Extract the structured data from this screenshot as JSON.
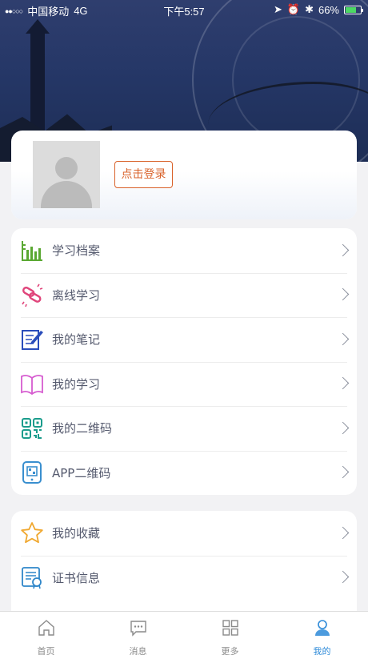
{
  "status": {
    "carrier": "中国移动",
    "network": "4G",
    "time": "下午5:57",
    "battery": "66%",
    "battery_level": 0.66
  },
  "profile": {
    "login_label": "点击登录"
  },
  "menu_group_1": [
    {
      "label": "学习档案",
      "icon": "chart-bars-icon",
      "color": "#5aa832"
    },
    {
      "label": "离线学习",
      "icon": "offline-link-icon",
      "color": "#e0457b"
    },
    {
      "label": "我的笔记",
      "icon": "notes-icon",
      "color": "#2a4dbb"
    },
    {
      "label": "我的学习",
      "icon": "book-icon",
      "color": "#d65cd0"
    },
    {
      "label": "我的二维码",
      "icon": "qrcode-icon",
      "color": "#1a9c8c"
    },
    {
      "label": "APP二维码",
      "icon": "app-qrcode-icon",
      "color": "#3a8fcf"
    }
  ],
  "menu_group_2": [
    {
      "label": "我的收藏",
      "icon": "star-icon",
      "color": "#f0a830"
    },
    {
      "label": "证书信息",
      "icon": "certificate-icon",
      "color": "#2f86c9"
    }
  ],
  "tabs": [
    {
      "label": "首页",
      "icon": "home-icon"
    },
    {
      "label": "消息",
      "icon": "message-icon"
    },
    {
      "label": "更多",
      "icon": "grid-icon"
    },
    {
      "label": "我的",
      "icon": "user-icon",
      "active": true
    }
  ],
  "colors": {
    "accent": "#2d8ad8",
    "login": "#d9622a"
  }
}
